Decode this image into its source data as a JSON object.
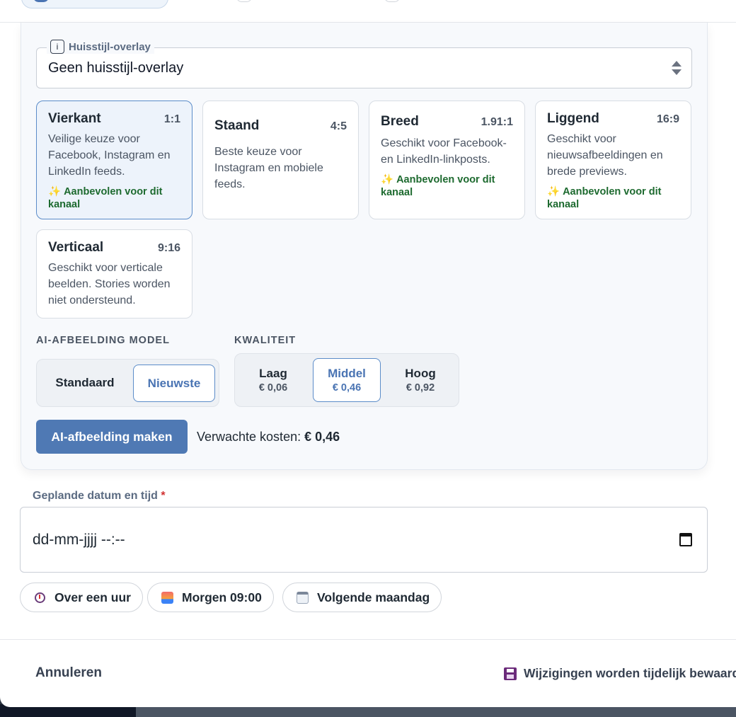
{
  "overlay": {
    "legend": "Huisstijl-overlay",
    "value": "Geen huisstijl-overlay"
  },
  "formats": [
    {
      "title": "Vierkant",
      "ratio": "1:1",
      "desc": "Veilige keuze voor Facebook, Instagram en LinkedIn feeds.",
      "rec": "Aanbevolen voor dit kanaal",
      "selected": true
    },
    {
      "title": "Staand",
      "ratio": "4:5",
      "desc": "Beste keuze voor Instagram en mobiele feeds.",
      "rec": ""
    },
    {
      "title": "Breed",
      "ratio": "1.91:1",
      "desc": "Geschikt voor Facebook- en LinkedIn-linkposts.",
      "rec": "Aanbevolen voor dit kanaal"
    },
    {
      "title": "Liggend",
      "ratio": "16:9",
      "desc": "Geschikt voor nieuwsafbeeldingen en brede previews.",
      "rec": "Aanbevolen voor dit kanaal"
    },
    {
      "title": "Verticaal",
      "ratio": "9:16",
      "desc": "Geschikt voor verticale beelden. Stories worden niet ondersteund.",
      "rec": ""
    }
  ],
  "model": {
    "label": "AI-AFBEELDING MODEL",
    "options": [
      "Standaard",
      "Nieuwste"
    ],
    "selected": "Nieuwste"
  },
  "quality": {
    "label": "KWALITEIT",
    "options": [
      {
        "label": "Laag",
        "price": "€ 0,06"
      },
      {
        "label": "Middel",
        "price": "€ 0,46"
      },
      {
        "label": "Hoog",
        "price": "€ 0,92"
      }
    ],
    "selected": "Middel"
  },
  "generate_button": "AI-afbeelding maken",
  "cost": {
    "label": "Verwachte kosten:",
    "value": "€ 0,46"
  },
  "schedule": {
    "label": "Geplande datum en tijd",
    "required_mark": "*",
    "placeholder": "dd-mm-jjjj --:--",
    "chips": [
      "Over een uur",
      "Morgen 09:00",
      "Volgende maandag"
    ]
  },
  "footer": {
    "cancel": "Annuleren",
    "save_note": "Wijzigingen worden tijdelijk bewaard i"
  },
  "icons": {
    "info": "info-icon",
    "sparkle": "sparkle-icon",
    "calendar": "calendar-icon",
    "timer": "timer-icon",
    "sunrise": "sunrise-icon",
    "calendar_small": "calendar-small-icon",
    "floppy": "floppy-disk-icon"
  },
  "colors": {
    "accent": "#4f79b4",
    "recommended": "#1d6a2f",
    "required": "#d03030"
  }
}
